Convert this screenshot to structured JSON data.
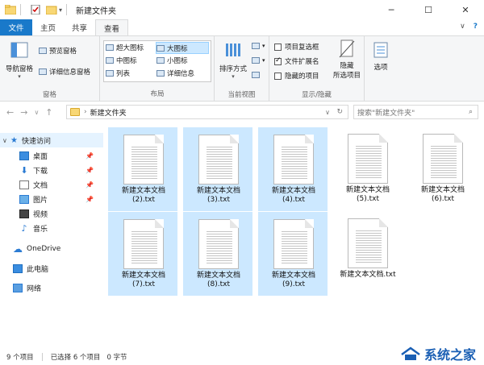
{
  "window": {
    "title": "新建文件夹",
    "minimize": "─",
    "maximize": "☐",
    "close": "✕"
  },
  "ribbon_tabs": [
    "文件",
    "主页",
    "共享",
    "查看"
  ],
  "ribbon_right": {
    "collapse": "∨",
    "help": "?"
  },
  "ribbon": {
    "nav_pane": "导航窗格",
    "preview_pane": "预览窗格",
    "details_pane": "详细信息窗格",
    "pane_group": "窗格",
    "layout_items": [
      "超大图标",
      "大图标",
      "中图标",
      "小图标",
      "列表",
      "详细信息"
    ],
    "layout_group": "布局",
    "sort_by": "排序方式",
    "current_view_group": "当前视图",
    "item_checkbox": "项目复选框",
    "file_ext": "文件扩展名",
    "hidden_items": "隐藏的项目",
    "hide_selected": "隐藏",
    "hide_selected2": "所选项目",
    "showhide_group": "显示/隐藏",
    "options": "选项"
  },
  "address": {
    "path": "新建文件夹",
    "search_placeholder": "搜索\"新建文件夹\""
  },
  "nav": {
    "quick_access": "快速访问",
    "items": [
      "桌面",
      "下载",
      "文档",
      "图片",
      "视频",
      "音乐"
    ],
    "onedrive": "OneDrive",
    "this_pc": "此电脑",
    "network": "网络"
  },
  "files": [
    {
      "name": "新建文本文档\n(2).txt",
      "selected": true
    },
    {
      "name": "新建文本文档\n(3).txt",
      "selected": true
    },
    {
      "name": "新建文本文档\n(4).txt",
      "selected": true
    },
    {
      "name": "新建文本文档\n(5).txt",
      "selected": false
    },
    {
      "name": "新建文本文档\n(6).txt",
      "selected": false
    },
    {
      "name": "新建文本文档\n(7).txt",
      "selected": true
    },
    {
      "name": "新建文本文档\n(8).txt",
      "selected": true
    },
    {
      "name": "新建文本文档\n(9).txt",
      "selected": true
    },
    {
      "name": "新建文本文档.txt",
      "selected": false
    }
  ],
  "status": {
    "count": "9 个项目",
    "selected": "已选择 6 个项目",
    "size": "0 字节"
  },
  "watermark": "系统之家",
  "colors": {
    "accent": "#1979ca",
    "selection": "#cce8ff"
  }
}
